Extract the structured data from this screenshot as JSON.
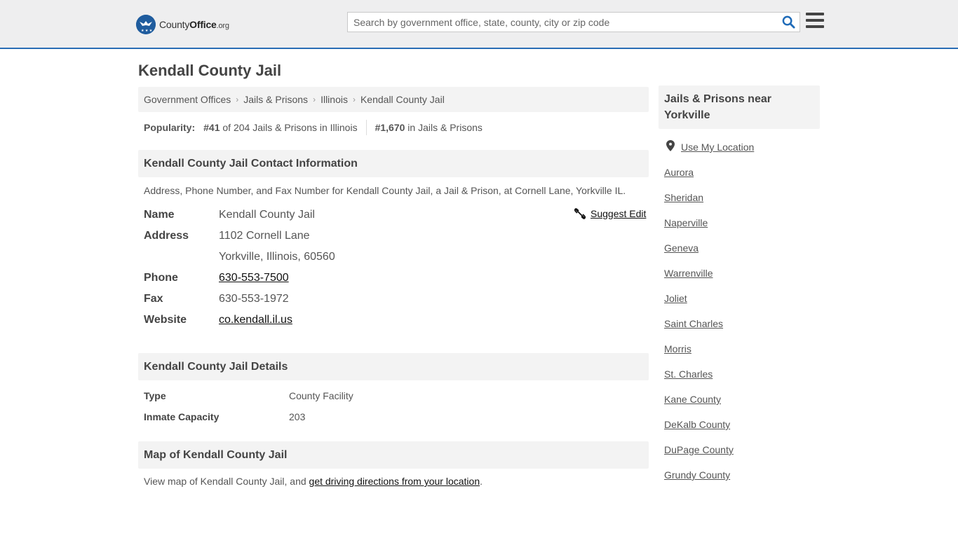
{
  "header": {
    "logo": {
      "part1": "County",
      "part2": "Office",
      "part3": ".org"
    },
    "search_placeholder": "Search by government office, state, county, city or zip code"
  },
  "page_title": "Kendall County Jail",
  "breadcrumb": [
    "Government Offices",
    "Jails & Prisons",
    "Illinois",
    "Kendall County Jail"
  ],
  "popularity": {
    "label": "Popularity:",
    "rank_state": "#41",
    "rank_state_text": "of 204 Jails & Prisons in Illinois",
    "rank_national": "#1,670",
    "rank_national_text": "in Jails & Prisons"
  },
  "contact": {
    "heading": "Kendall County Jail Contact Information",
    "description": "Address, Phone Number, and Fax Number for Kendall County Jail, a Jail & Prison, at Cornell Lane, Yorkville IL.",
    "suggest_edit": "Suggest Edit",
    "name_label": "Name",
    "name": "Kendall County Jail",
    "address_label": "Address",
    "address_line1": "1102 Cornell Lane",
    "address_line2": "Yorkville, Illinois, 60560",
    "phone_label": "Phone",
    "phone": "630-553-7500",
    "fax_label": "Fax",
    "fax": "630-553-1972",
    "website_label": "Website",
    "website": "co.kendall.il.us"
  },
  "details": {
    "heading": "Kendall County Jail Details",
    "type_label": "Type",
    "type": "County Facility",
    "capacity_label": "Inmate Capacity",
    "capacity": "203"
  },
  "map": {
    "heading": "Map of Kendall County Jail",
    "text": "View map of Kendall County Jail, and",
    "link": "get driving directions from your location",
    "end": "."
  },
  "sidebar": {
    "heading": "Jails & Prisons near Yorkville",
    "use_location": "Use My Location",
    "items": [
      "Aurora",
      "Sheridan",
      "Naperville",
      "Geneva",
      "Warrenville",
      "Joliet",
      "Saint Charles",
      "Morris",
      "St. Charles",
      "Kane County",
      "DeKalb County",
      "DuPage County",
      "Grundy County"
    ]
  },
  "colors": {
    "accent": "#2a6db5",
    "logo": "#1f5c9e",
    "search_icon": "#1f6bb8"
  }
}
